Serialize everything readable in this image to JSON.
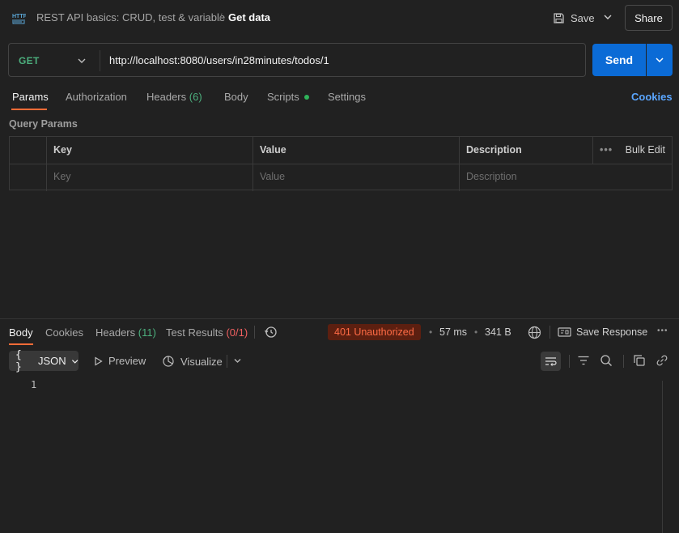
{
  "header": {
    "collection": "REST API basics: CRUD, test & variable",
    "separator": "/",
    "request_name": "Get data",
    "save_label": "Save",
    "share_label": "Share"
  },
  "request": {
    "method": "GET",
    "url": "http://localhost:8080/users/in28minutes/todos/1",
    "send_label": "Send"
  },
  "request_tabs": {
    "params": "Params",
    "authorization": "Authorization",
    "headers": "Headers",
    "headers_count": "(6)",
    "body": "Body",
    "scripts": "Scripts",
    "settings": "Settings",
    "cookies": "Cookies"
  },
  "query_params": {
    "title": "Query Params",
    "columns": [
      "Key",
      "Value",
      "Description"
    ],
    "bulk_edit": "Bulk Edit",
    "placeholders": [
      "Key",
      "Value",
      "Description"
    ]
  },
  "response": {
    "tabs": {
      "body": "Body",
      "cookies": "Cookies",
      "headers": "Headers",
      "headers_count": "(11)",
      "tests": "Test Results",
      "tests_count": "(0/1)"
    },
    "status": "401 Unauthorized",
    "time": "57 ms",
    "size": "341 B",
    "save_response": "Save Response",
    "format": "JSON",
    "preview": "Preview",
    "visualize": "Visualize",
    "line_number": "1"
  },
  "colors": {
    "accent": "#ff6c37",
    "send": "#0b6bd6",
    "method": "#4caf7d",
    "error": "#ff6b45",
    "link": "#5aa6ff"
  }
}
